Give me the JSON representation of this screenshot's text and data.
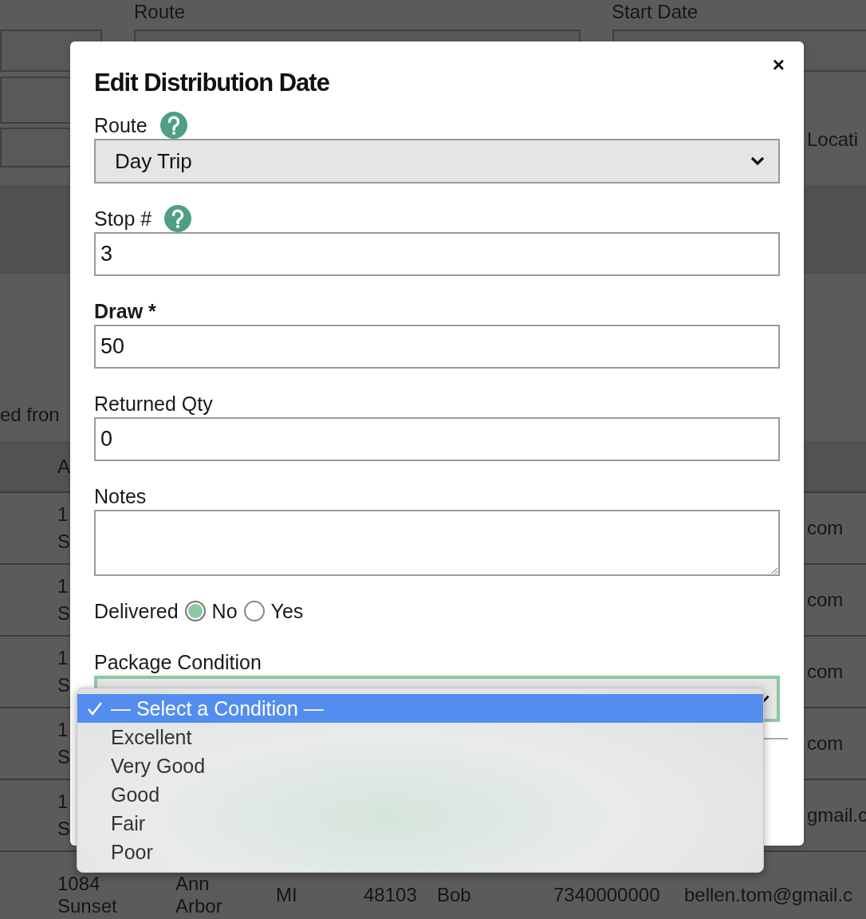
{
  "background": {
    "labels": [
      "Route",
      "Start Date"
    ],
    "side_label": "Locati",
    "caption": "ed fron",
    "table_header": "A",
    "rows": [
      {
        "cell": "1 S",
        "end": "com"
      },
      {
        "cell": "1 S",
        "end": "com"
      },
      {
        "cell": "1 S",
        "end": "com"
      },
      {
        "cell": "1 S",
        "end": "com"
      },
      {
        "cell": "1 S",
        "end": "gmail.c"
      }
    ],
    "last_row": [
      "1084 Sunset",
      "Ann Arbor",
      "MI",
      "48103",
      "Bob",
      "7340000000",
      "bellen.tom@gmail.c"
    ]
  },
  "dialog": {
    "title": "Edit Distribution Date",
    "close": "×",
    "fields": [
      {
        "kind": "select",
        "label": "Route",
        "bold": false,
        "help": true,
        "value": "Day Trip"
      },
      {
        "kind": "input",
        "label": "Stop #",
        "bold": false,
        "help": true,
        "value": "3"
      },
      {
        "kind": "input",
        "label": "Draw *",
        "bold": true,
        "help": false,
        "value": "50"
      },
      {
        "kind": "input",
        "label": "Returned Qty",
        "bold": false,
        "help": false,
        "value": "0"
      },
      {
        "kind": "textarea",
        "label": "Notes",
        "bold": false,
        "help": false
      },
      {
        "kind": "radio",
        "label": "Delivered",
        "bold": false,
        "help": false,
        "options": [
          {
            "label": "No",
            "selected": true
          },
          {
            "label": "Yes",
            "selected": false
          }
        ]
      },
      {
        "kind": "dropdown",
        "label": "Package Condition",
        "bold": false,
        "help": false,
        "focused": true,
        "options": [
          {
            "label": "— Select a Condition —",
            "selected": true
          },
          {
            "label": "Excellent",
            "selected": false
          },
          {
            "label": "Very Good",
            "selected": false
          },
          {
            "label": "Good",
            "selected": false
          },
          {
            "label": "Fair",
            "selected": false
          },
          {
            "label": "Poor",
            "selected": false
          }
        ]
      }
    ]
  }
}
